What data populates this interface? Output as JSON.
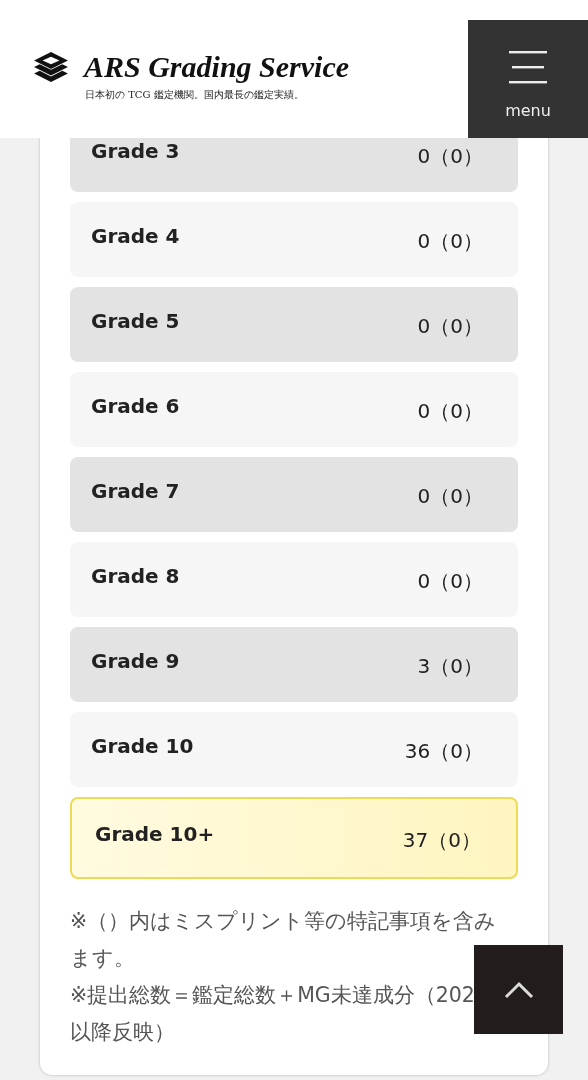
{
  "header": {
    "logo_title": "ARS Grading Service",
    "tagline": "日本初の TCG 鑑定機関。国内最長の鑑定実績。",
    "menu_label": "menu"
  },
  "grades": [
    {
      "label": "Grade 3",
      "value": "0（0）",
      "kind": "shaded"
    },
    {
      "label": "Grade 4",
      "value": "0（0）",
      "kind": "plain"
    },
    {
      "label": "Grade 5",
      "value": "0（0）",
      "kind": "shaded"
    },
    {
      "label": "Grade 6",
      "value": "0（0）",
      "kind": "plain"
    },
    {
      "label": "Grade 7",
      "value": "0（0）",
      "kind": "shaded"
    },
    {
      "label": "Grade 8",
      "value": "0（0）",
      "kind": "plain"
    },
    {
      "label": "Grade 9",
      "value": "3（0）",
      "kind": "shaded"
    },
    {
      "label": "Grade 10",
      "value": "36（0）",
      "kind": "plain"
    },
    {
      "label": "Grade 10+",
      "value": "37（0）",
      "kind": "highlight"
    }
  ],
  "notes": [
    "※（）内はミスプリント等の特記事項を含みます。",
    "※提出総数＝鑑定総数＋MG未達成分（202",
    "以降反映）"
  ]
}
